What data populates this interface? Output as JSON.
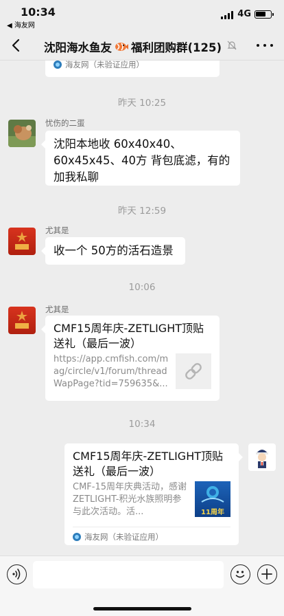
{
  "status": {
    "time": "10:34",
    "back_app": "◀ 海友网",
    "network": "4G"
  },
  "nav": {
    "title_part1": "沈阳海水鱼友",
    "title_part2": "福利团购群(125)"
  },
  "chat": {
    "top_card_source": "海友网（未验证应用）",
    "timestamps": [
      "昨天 10:25",
      "昨天 12:59",
      "10:06",
      "10:34"
    ],
    "msg1": {
      "sender": "忧伤的二蛋",
      "text": "沈阳本地收 60x40x40、60x45x45、40方 背包底滤，有的加我私聊"
    },
    "msg2": {
      "sender": "尤其是",
      "text": "收一个 50方的活石造景"
    },
    "msg3": {
      "sender": "尤其是",
      "title": "CMF15周年庆-ZETLIGHT顶贴送礼（最后一波）",
      "desc": "https://app.cmfish.com/mag/circle/v1/forum/threadWapPage?tid=759635&..."
    },
    "msg4": {
      "title": "CMF15周年庆-ZETLIGHT顶贴送礼（最后一波）",
      "desc": "CMF-15周年庆典活动，感谢 ZETLIGHT-积光水族照明参与此次活动。活...",
      "source": "海友网（未验证应用）",
      "thumb_label": "11周年"
    }
  },
  "colors": {
    "background": "#ededed",
    "bubble": "#ffffff",
    "timestamp": "#9b9b9b"
  }
}
